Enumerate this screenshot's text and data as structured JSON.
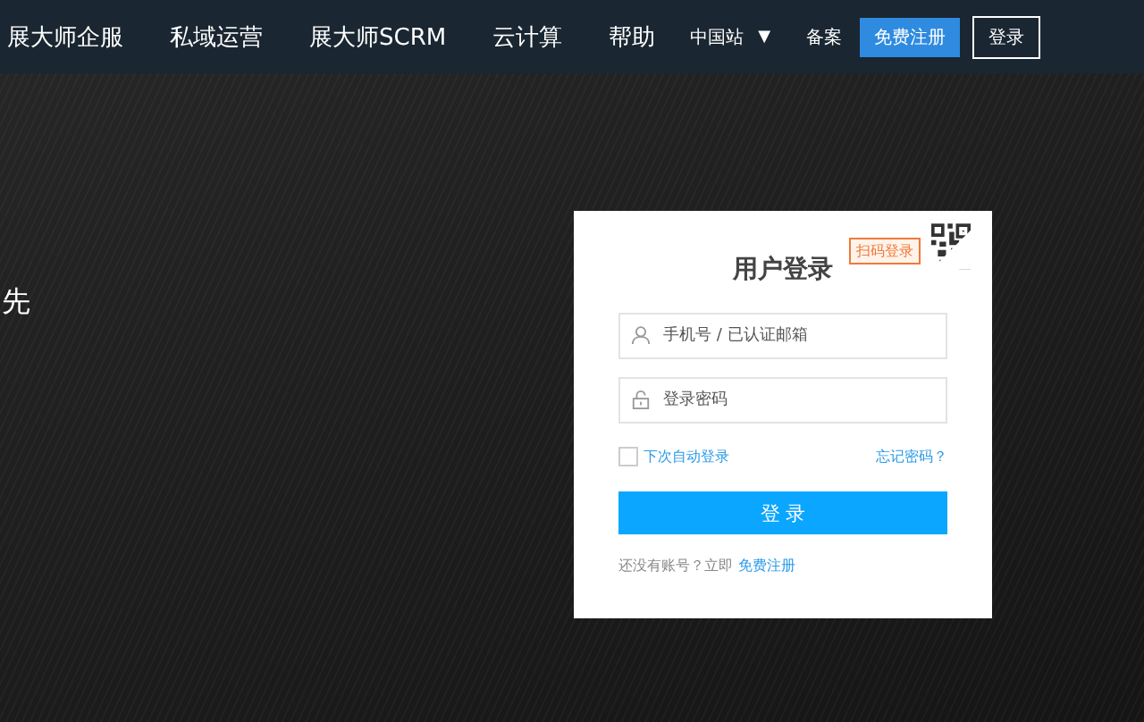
{
  "nav": {
    "items": [
      "展大师企服",
      "私域运营",
      "展大师SCRM",
      "云计算",
      "帮助"
    ],
    "region": "中国站",
    "region_caret": "▼",
    "filing": "备案",
    "register_button": "免费注册",
    "login_button": "登录"
  },
  "hero": {
    "text": "先"
  },
  "login": {
    "title": "用户登录",
    "qr_badge": "扫码登录",
    "account_placeholder": "手机号 / 已认证邮箱",
    "password_placeholder": "登录密码",
    "remember": {
      "label": "下次自动登录",
      "checked": false
    },
    "forgot": "忘记密码？",
    "submit": "登 录",
    "signup_prompt": "还没有账号？立即",
    "signup_link": "免费注册"
  }
}
